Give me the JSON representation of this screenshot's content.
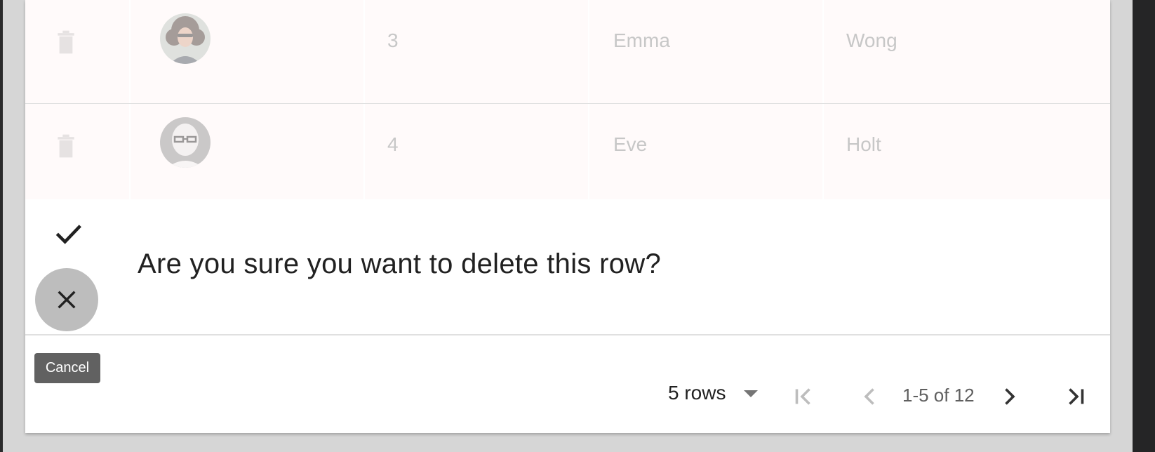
{
  "table": {
    "rows": [
      {
        "id": "3",
        "first_name": "Emma",
        "last_name": "Wong",
        "avatar": "curly-hair-woman-avatar"
      },
      {
        "id": "4",
        "first_name": "Eve",
        "last_name": "Holt",
        "avatar": "bald-man-glasses-avatar"
      }
    ],
    "delete_icon": "trash-icon"
  },
  "confirm": {
    "message": "Are you sure you want to delete this row?",
    "confirm_icon": "check-icon",
    "cancel_icon": "close-icon",
    "tooltip": "Cancel"
  },
  "pagination": {
    "rows_per_page": "5 rows",
    "range": "1-5 of 12",
    "icons": [
      "first-page-icon",
      "previous-page-icon",
      "next-page-icon",
      "last-page-icon"
    ]
  },
  "colors": {
    "row_background": "#fffafa",
    "cancel_button": "#bdbdbd",
    "tooltip": "#616161"
  }
}
